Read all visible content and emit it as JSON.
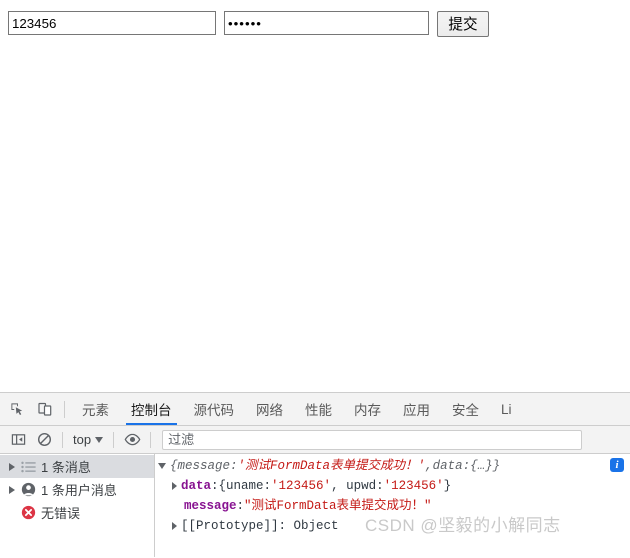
{
  "page": {
    "username_field": {
      "value": "123456",
      "placeholder": ""
    },
    "password_field": {
      "value": "••••••",
      "placeholder": ""
    },
    "submit_button_label": "提交"
  },
  "devtools": {
    "toolbar_icons": [
      {
        "name": "inspect-element-icon"
      },
      {
        "name": "device-toolbar-icon"
      }
    ],
    "tabs": [
      {
        "label": "元素",
        "active": false
      },
      {
        "label": "控制台",
        "active": true
      },
      {
        "label": "源代码",
        "active": false
      },
      {
        "label": "网络",
        "active": false
      },
      {
        "label": "性能",
        "active": false
      },
      {
        "label": "内存",
        "active": false
      },
      {
        "label": "应用",
        "active": false
      },
      {
        "label": "安全",
        "active": false
      },
      {
        "label": "Li",
        "active": false
      }
    ],
    "console_toolbar": {
      "sidebar_toggle_icon": "sidebar-toggle-icon",
      "clear_console_icon": "clear-console-icon",
      "context_value": "top",
      "eye_icon": "live-expression-eye-icon",
      "filter_placeholder": "过滤",
      "filter_value": ""
    },
    "sidebar": [
      {
        "label": "1 条消息",
        "icon": "messages-list-icon",
        "selected": true,
        "expandable": true
      },
      {
        "label": "1 条用户消息",
        "icon": "user-message-icon",
        "selected": false,
        "expandable": true
      },
      {
        "label": "无错误",
        "icon": "error-icon",
        "selected": false,
        "expandable": false
      }
    ],
    "console_log": {
      "line1": {
        "open_brace": "{",
        "key1": "message",
        "colon": ": ",
        "value1": "'测试FormData表单提交成功！'",
        "comma": ", ",
        "key2": "data",
        "value2": "{…}",
        "close_brace": "}",
        "badge": "i"
      },
      "line2": {
        "key": "data",
        "colon": ": ",
        "value": "{uname: ",
        "str1": "'123456'",
        "mid": ", upwd: ",
        "str2": "'123456'",
        "close": "}"
      },
      "line3": {
        "key": "message",
        "colon": ": ",
        "value": "\"测试FormData表单提交成功！\""
      },
      "line4": {
        "text": "[[Prototype]]: Object"
      }
    },
    "watermark": "CSDN @坚毅的小解同志"
  },
  "colors": {
    "accent_blue": "#1a73e8",
    "string_red": "#c41a16",
    "key_purple": "#881391",
    "error_red": "#dc3545",
    "toolbar_bg": "#f3f3f3"
  }
}
